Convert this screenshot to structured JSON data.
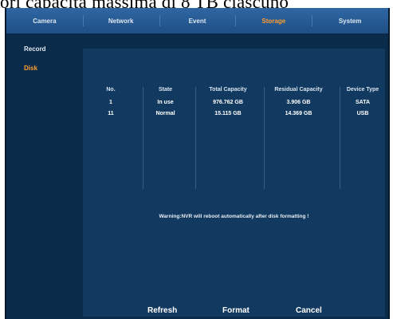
{
  "caption": "ori capacità massima di 8 TB ciascuno",
  "nav": {
    "tabs": [
      "Camera",
      "Network",
      "Event",
      "Storage",
      "System"
    ],
    "active_tab": "Storage"
  },
  "sidebar": {
    "items": [
      "Record",
      "Disk"
    ],
    "active_item": "Disk"
  },
  "disk_table": {
    "headers": {
      "no": "No.",
      "state": "State",
      "total": "Total Capacity",
      "residual": "Residual Capacity",
      "type": "Device Type"
    },
    "rows": [
      {
        "no": "1",
        "state": "In use",
        "total": "976.762 GB",
        "residual": "3.906 GB",
        "type": "SATA"
      },
      {
        "no": "11",
        "state": "Normal",
        "total": "15.115 GB",
        "residual": "14.369 GB",
        "type": "USB"
      }
    ]
  },
  "warning": "Warning:NVR will reboot automatically after disk formatting !",
  "buttons": {
    "refresh": "Refresh",
    "format": "Format",
    "cancel": "Cancel"
  },
  "colors": {
    "active": "#ff9f2f",
    "background": "#0b2b4a",
    "panel": "#123a60",
    "nav": "#2f67a3"
  }
}
